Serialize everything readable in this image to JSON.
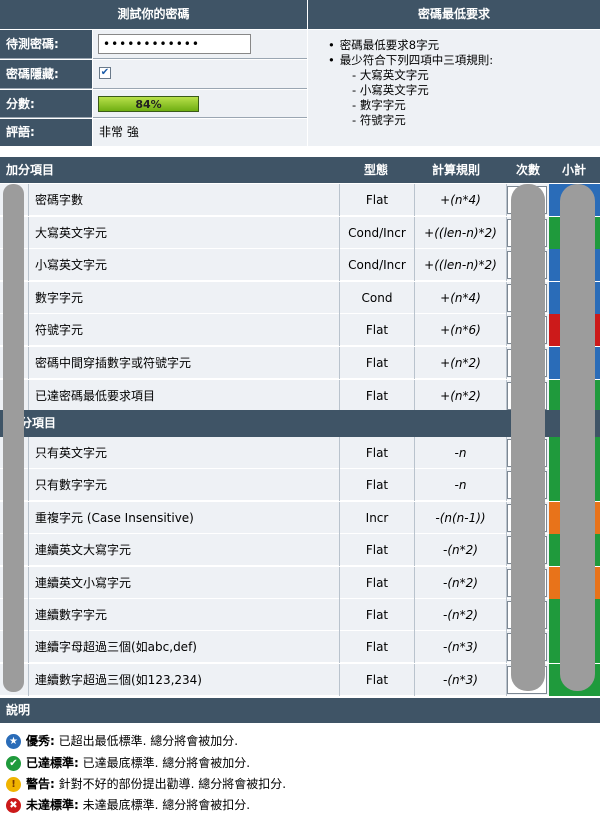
{
  "top": {
    "left_title": "測試你的密碼",
    "right_title": "密碼最低要求",
    "password_label": "待測密碼:",
    "password_value": "••••••••••••",
    "hide_label": "密碼隱藏:",
    "hide_checked_glyph": "✔",
    "score_label": "分數:",
    "score_value": "84%",
    "score_fraction": 0.84,
    "rating_label": "評語:",
    "rating_value": "非常 強"
  },
  "requirements": {
    "items": [
      "密碼最低要求8字元",
      "最少符合下列四項中三項規則:"
    ],
    "sub_items": [
      "大寫英文字元",
      "小寫英文字元",
      "數字字元",
      "符號字元"
    ]
  },
  "table": {
    "headers": {
      "name": "加分項目",
      "type": "型態",
      "rule": "計算規則",
      "count": "次數",
      "subtotal": "小計"
    },
    "add_rows": [
      {
        "name": "密碼字數",
        "type": "Flat",
        "rule": "+(n*4)",
        "status_color": "#2a6cb8"
      },
      {
        "name": "大寫英文字元",
        "type": "Cond/Incr",
        "rule": "+((len-n)*2)",
        "status_color": "#1f9a3c"
      },
      {
        "name": "小寫英文字元",
        "type": "Cond/Incr",
        "rule": "+((len-n)*2)",
        "status_color": "#2a6cb8"
      },
      {
        "name": "數字字元",
        "type": "Cond",
        "rule": "+(n*4)",
        "status_color": "#2a6cb8"
      },
      {
        "name": "符號字元",
        "type": "Flat",
        "rule": "+(n*6)",
        "status_color": "#cc1a1a"
      },
      {
        "name": "密碼中間穿插數字或符號字元",
        "type": "Flat",
        "rule": "+(n*2)",
        "status_color": "#2a6cb8"
      },
      {
        "name": "已達密碼最低要求項目",
        "type": "Flat",
        "rule": "+(n*2)",
        "status_color": "#1f9a3c"
      }
    ],
    "deduct_header": "分項目",
    "deduct_rows": [
      {
        "name": "只有英文字元",
        "type": "Flat",
        "rule": "-n",
        "status_color": "#1f9a3c"
      },
      {
        "name": "只有數字字元",
        "type": "Flat",
        "rule": "-n",
        "status_color": "#1f9a3c"
      },
      {
        "name": "重複字元 (Case Insensitive)",
        "type": "Incr",
        "rule": "-(n(n-1))",
        "status_color": "#e8731a"
      },
      {
        "name": "連續英文大寫字元",
        "type": "Flat",
        "rule": "-(n*2)",
        "status_color": "#1f9a3c"
      },
      {
        "name": "連續英文小寫字元",
        "type": "Flat",
        "rule": "-(n*2)",
        "status_color": "#e8731a"
      },
      {
        "name": "連續數字字元",
        "type": "Flat",
        "rule": "-(n*2)",
        "status_color": "#1f9a3c"
      },
      {
        "name": "連續字母超過三個(如abc,def)",
        "type": "Flat",
        "rule": "-(n*3)",
        "status_color": "#1f9a3c"
      },
      {
        "name": "連續數字超過三個(如123,234)",
        "type": "Flat",
        "rule": "-(n*3)",
        "status_color": "#1f9a3c"
      }
    ]
  },
  "legend": {
    "title": "說明",
    "items": [
      {
        "icon": "star-icon",
        "color": "#2a6cb8",
        "glyph": "★",
        "label": "優秀:",
        "text": "已超出最低標準. 總分將會被加分."
      },
      {
        "icon": "check-icon",
        "color": "#1f9a3c",
        "glyph": "✔",
        "label": "已達標準:",
        "text": "已達最底標準. 總分將會被加分."
      },
      {
        "icon": "warning-icon",
        "color": "#f0b400",
        "glyph": "!",
        "label": "警告:",
        "text": "針對不好的部份提出勸導. 總分將會被扣分."
      },
      {
        "icon": "cross-icon",
        "color": "#cc1a1a",
        "glyph": "✖",
        "label": "未達標準:",
        "text": "未達最底標準. 總分將會被扣分."
      }
    ]
  }
}
